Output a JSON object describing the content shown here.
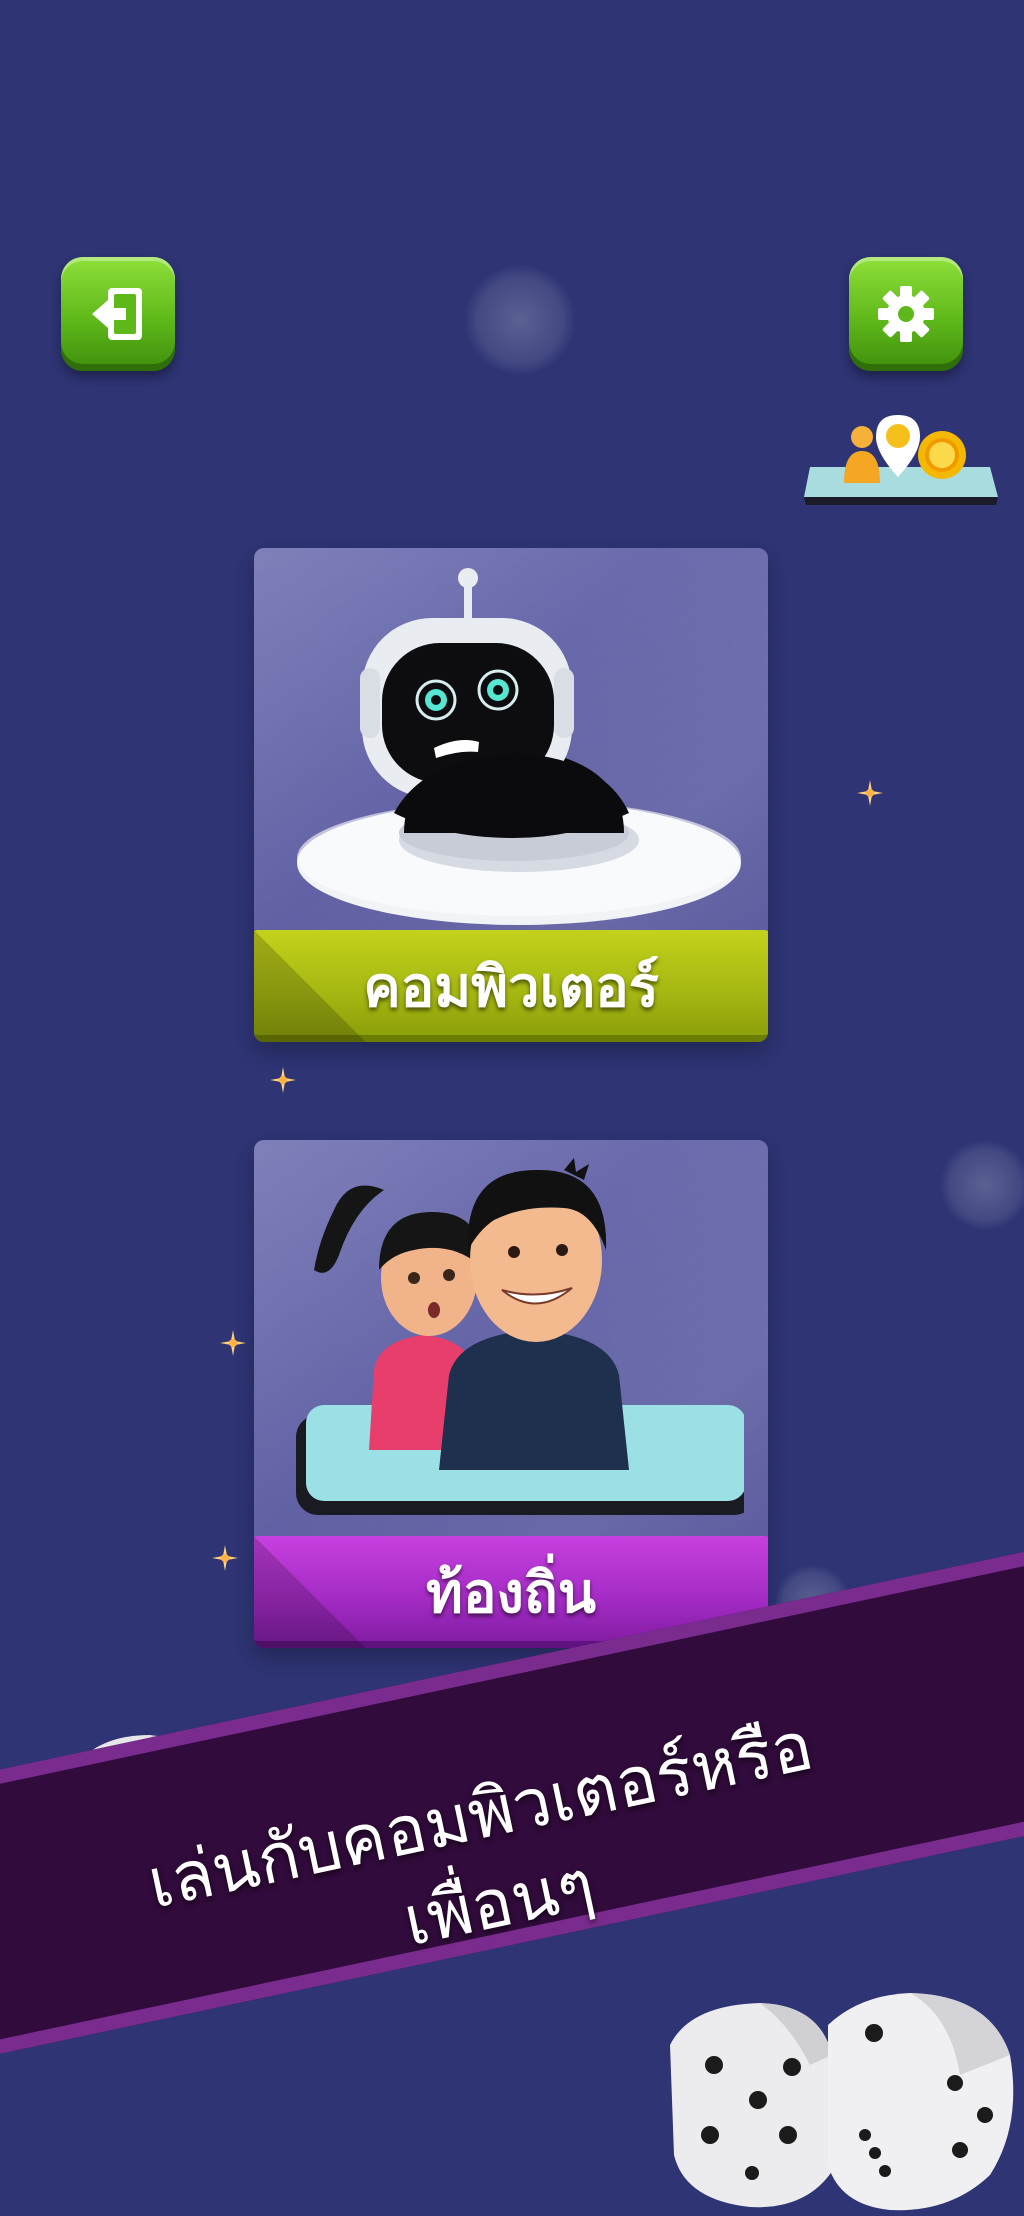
{
  "header": {
    "exit_icon": "exit-door-icon",
    "settings_icon": "gear-icon",
    "location_icon": "player-location-coins-icon"
  },
  "modes": [
    {
      "label": "คอมพิวเตอร์",
      "icon": "robot-ufo-icon",
      "color": "#a6b812"
    },
    {
      "label": "ท้องถิ่น",
      "icon": "kids-phone-icon",
      "color": "#a52cc6"
    }
  ],
  "promo": {
    "line1": "เล่นกับคอมพิวเตอร์หรือ",
    "line2": "เพื่อนๆ"
  },
  "colors": {
    "background": "#2e3474",
    "button_green": "#5fb81a",
    "ribbon": "#310b3b"
  }
}
